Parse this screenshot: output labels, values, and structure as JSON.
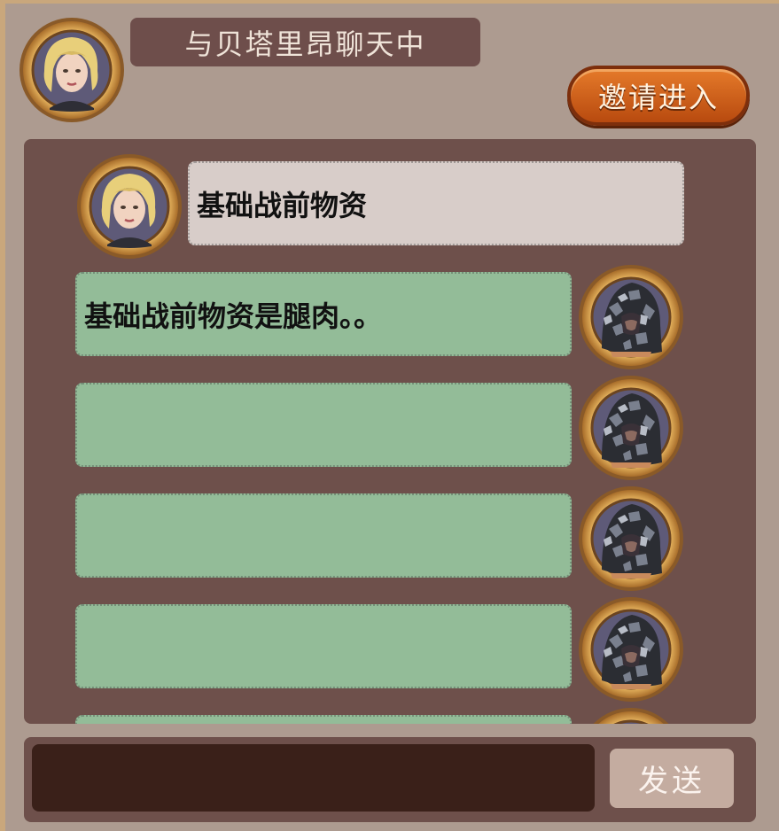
{
  "header": {
    "title": "与贝塔里昂聊天中",
    "invite_label": "邀请进入",
    "avatar_icon": "npc-blonde-girl-portrait"
  },
  "messages": [
    {
      "side": "left",
      "text": "基础战前物资",
      "avatar_icon": "npc-blonde-girl-portrait"
    },
    {
      "side": "right",
      "text": "基础战前物资是腿肉。。",
      "avatar_icon": "player-hooded-camo-portrait"
    },
    {
      "side": "right",
      "text": "",
      "avatar_icon": "player-hooded-camo-portrait"
    },
    {
      "side": "right",
      "text": "",
      "avatar_icon": "player-hooded-camo-portrait"
    },
    {
      "side": "right",
      "text": "",
      "avatar_icon": "player-hooded-camo-portrait"
    },
    {
      "side": "right",
      "text": "",
      "avatar_icon": "player-hooded-camo-portrait"
    }
  ],
  "composer": {
    "input_value": "",
    "send_label": "发送"
  },
  "colors": {
    "panel": "#6e504b",
    "left_bubble": "#d8cdc9",
    "right_bubble": "#93bc98",
    "invite_button": "#d0621c",
    "frame_wood": "#c9a77c"
  }
}
